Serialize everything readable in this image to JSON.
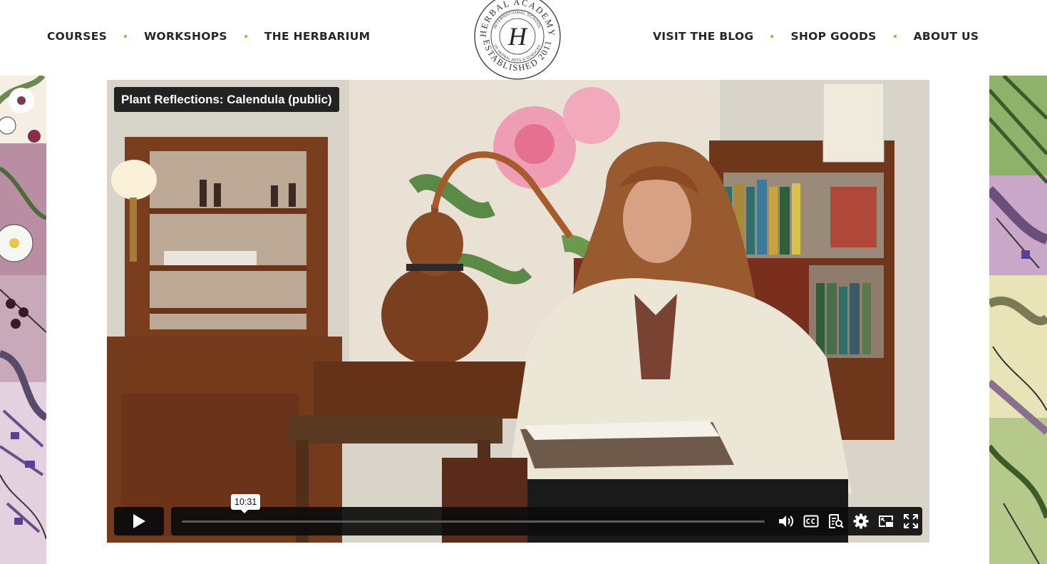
{
  "header": {
    "nav_left": [
      {
        "label": "COURSES"
      },
      {
        "label": "WORKSHOPS"
      },
      {
        "label": "THE HERBARIUM"
      }
    ],
    "nav_right": [
      {
        "label": "VISIT THE BLOG"
      },
      {
        "label": "SHOP GOODS"
      },
      {
        "label": "ABOUT US"
      }
    ],
    "logo": {
      "letter": "H",
      "outer_top": "HERBAL ACADEMY",
      "outer_bottom": "ESTABLISHED 2011",
      "inner_top": "INTERNATIONAL SCHOOL",
      "inner_bottom": "OF HERBAL ARTS & SCIENCES"
    },
    "accent_color": "#c9a227"
  },
  "video": {
    "title": "Plant Reflections: Calendula (public)",
    "controls": {
      "time_tooltip": "10:31",
      "progress": 0,
      "icons": [
        "play-icon",
        "volume-icon",
        "closed-captions-icon",
        "transcript-icon",
        "settings-icon",
        "picture-in-picture-icon",
        "fullscreen-icon"
      ]
    }
  }
}
